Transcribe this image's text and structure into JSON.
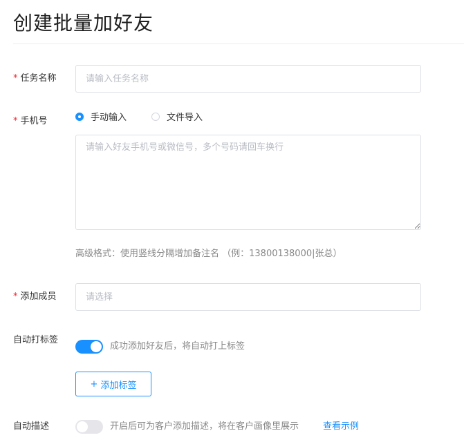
{
  "page": {
    "title": "创建批量加好友"
  },
  "form": {
    "task_name": {
      "required_mark": "*",
      "label": "任务名称",
      "placeholder": "请输入任务名称"
    },
    "phone": {
      "required_mark": "*",
      "label": "手机号",
      "options": [
        {
          "label": "手动输入",
          "selected": true
        },
        {
          "label": "文件导入",
          "selected": false
        }
      ],
      "textarea_placeholder": "请输入好友手机号或微信号，多个号码请回车换行",
      "advanced_hint": "高级格式：使用竖线分隔增加备注名 （例：13800138000|张总）"
    },
    "members": {
      "required_mark": "*",
      "label": "添加成员",
      "placeholder": "请选择"
    },
    "auto_tag": {
      "label": "自动打标签",
      "enabled": true,
      "hint": "成功添加好友后，将自动打上标签",
      "add_tag_button": {
        "icon": "+",
        "label": "添加标签"
      }
    },
    "auto_desc": {
      "label": "自动描述",
      "enabled": false,
      "hint": "开启后可为客户添加描述，将在客户画像里展示",
      "example_link": "查看示例"
    }
  },
  "colors": {
    "accent": "#1890ff",
    "required": "#f5222d",
    "border": "#dcdfe6",
    "switch_off": "#e6e6ea"
  }
}
